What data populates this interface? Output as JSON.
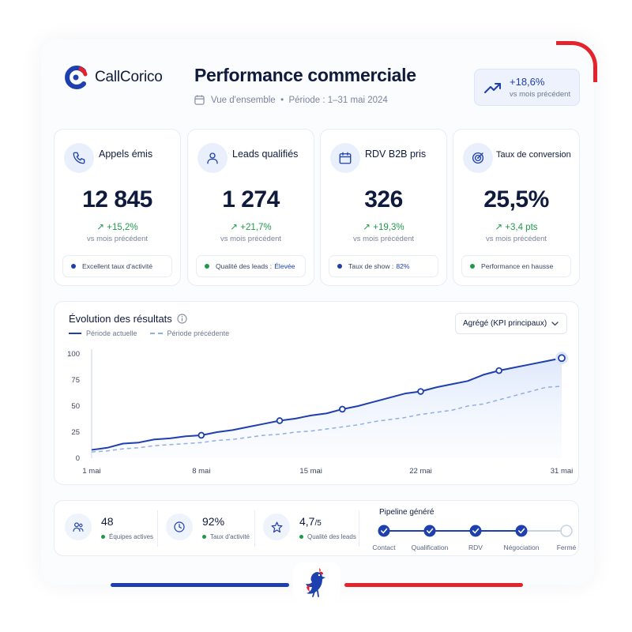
{
  "brand": {
    "name": "CallCorico"
  },
  "header": {
    "title": "Performance commerciale",
    "subtitle": "Vue d'ensemble  •  Période : 1–31 mai 2024",
    "badge_value": "+18,6%",
    "badge_sub": "vs mois précédent"
  },
  "colors": {
    "primary": "#1e3fae",
    "green": "#1f9a4a",
    "red": "#e4232b",
    "prev_series": "#8fb0e4"
  },
  "kpis": [
    {
      "icon": "phone-icon",
      "title": "Appels émis",
      "value": "12 845",
      "delta": "↗ +15,2%",
      "vs": "vs mois précédent",
      "footer": "Excellent taux d'activité",
      "footer_highlight": "",
      "dot": "#1e3fae"
    },
    {
      "icon": "user-icon",
      "title": "Leads qualifiés",
      "value": "1 274",
      "delta": "↗ +21,7%",
      "vs": "vs mois précédent",
      "footer": "Qualité des leads :",
      "footer_highlight": "Élevée",
      "dot": "#1f9a4a"
    },
    {
      "icon": "calendar-icon",
      "title": "RDV B2B pris",
      "value": "326",
      "delta": "↗ +19,3%",
      "vs": "vs mois précédent",
      "footer": "Taux de show :",
      "footer_highlight": "82%",
      "dot": "#1e3fae"
    },
    {
      "icon": "target-icon",
      "title": "Taux de conversion",
      "value": "25,5%",
      "delta": "↗ +3,4 pts",
      "vs": "vs mois précédent",
      "footer": "Performance en hausse",
      "footer_highlight": "",
      "dot": "#1f9a4a"
    }
  ],
  "chart_panel": {
    "title": "Évolution des résultats",
    "legend_current": "Période actuelle",
    "legend_previous": "Période précédente",
    "dropdown_value": "Agrégé (KPI principaux)"
  },
  "chart_data": {
    "type": "line",
    "x": [
      1,
      2,
      3,
      4,
      5,
      6,
      7,
      8,
      9,
      10,
      11,
      12,
      13,
      14,
      15,
      16,
      17,
      18,
      19,
      20,
      21,
      22,
      23,
      24,
      25,
      26,
      27,
      28,
      29,
      30,
      31
    ],
    "series": [
      {
        "name": "Période actuelle",
        "values": [
          8,
          10,
          14,
          15,
          18,
          19,
          21,
          22,
          25,
          27,
          30,
          33,
          36,
          38,
          41,
          43,
          47,
          50,
          54,
          58,
          62,
          64,
          68,
          71,
          74,
          80,
          84,
          87,
          90,
          93,
          96
        ]
      },
      {
        "name": "Période précédente",
        "values": [
          6,
          7,
          9,
          10,
          12,
          13,
          14,
          15,
          17,
          18,
          20,
          22,
          23,
          25,
          26,
          28,
          30,
          32,
          35,
          37,
          39,
          42,
          44,
          46,
          50,
          52,
          56,
          60,
          64,
          68,
          69
        ]
      }
    ],
    "xticks": [
      1,
      8,
      15,
      22,
      31
    ],
    "xtick_labels": [
      "1 mai",
      "8 mai",
      "15 mai",
      "22 mai",
      "31 mai"
    ],
    "yticks": [
      0,
      25,
      50,
      75,
      100
    ],
    "ylim": [
      0,
      100
    ],
    "xlim": [
      1,
      31
    ],
    "markers": [
      8,
      13,
      17,
      22,
      27,
      31
    ],
    "grid": false,
    "legend": "top-left"
  },
  "stats": [
    {
      "icon": "team-icon",
      "value": "48",
      "value_small": "",
      "label": "Équipes actives",
      "dot": "#1f9a4a"
    },
    {
      "icon": "clock-icon",
      "value": "92%",
      "value_small": "",
      "label": "Taux d'activité",
      "dot": "#1f9a4a"
    },
    {
      "icon": "star-icon",
      "value": "4,7",
      "value_small": "/5",
      "label": "Qualité des leads",
      "dot": "#1f9a4a"
    }
  ],
  "pipeline": {
    "title": "Pipeline généré",
    "steps": [
      {
        "label": "Contact",
        "done": true
      },
      {
        "label": "Qualification",
        "done": true
      },
      {
        "label": "RDV",
        "done": true
      },
      {
        "label": "Négociation",
        "done": true
      },
      {
        "label": "Fermé",
        "done": false
      }
    ]
  }
}
